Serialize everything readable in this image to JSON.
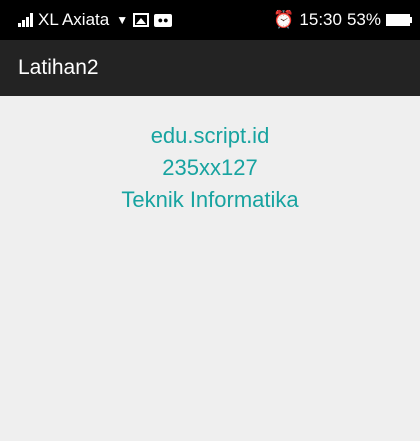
{
  "status_bar": {
    "carrier": "XL Axiata",
    "time": "15:30",
    "battery_percent": "53%",
    "icons": [
      "signal-icon",
      "wifi-icon",
      "image-icon",
      "message-icon",
      "alarm-icon",
      "battery-icon"
    ]
  },
  "app_bar": {
    "title": "Latihan2"
  },
  "content": {
    "lines": [
      "edu.script.id",
      "235xx127",
      "Teknik Informatika"
    ],
    "text_color": "#17a3a0"
  }
}
